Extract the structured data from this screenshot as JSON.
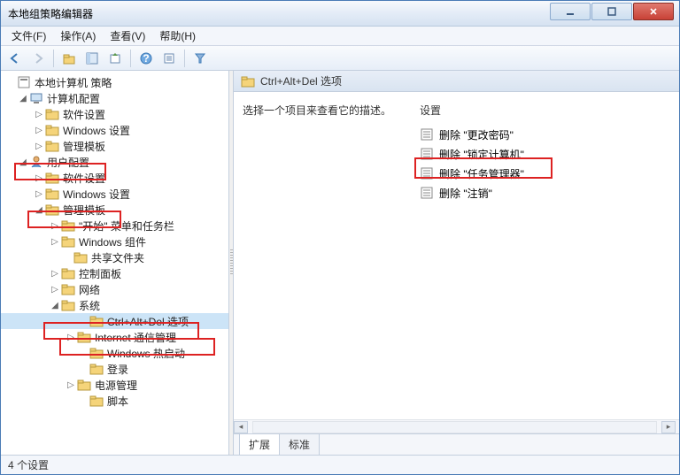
{
  "window": {
    "title": "本地组策略编辑器"
  },
  "menu": {
    "file": "文件(F)",
    "action": "操作(A)",
    "view": "查看(V)",
    "help": "帮助(H)"
  },
  "tree": {
    "root": "本地计算机 策略",
    "computer_config": "计算机配置",
    "cc_software": "软件设置",
    "cc_windows": "Windows 设置",
    "cc_admin": "管理模板",
    "user_config": "用户配置",
    "uc_software": "软件设置",
    "uc_windows": "Windows 设置",
    "uc_admin": "管理模板",
    "start_taskbar": "\"开始\" 菜单和任务栏",
    "win_components": "Windows 组件",
    "shared_folders": "共享文件夹",
    "control_panel": "控制面板",
    "network": "网络",
    "system": "系统",
    "ctrl_alt_del": "Ctrl+Alt+Del 选项",
    "internet_comm": "Internet 通信管理",
    "win_hotstart": "Windows 热启动",
    "logon": "登录",
    "power_mgmt": "电源管理",
    "scripts": "脚本"
  },
  "right": {
    "title": "Ctrl+Alt+Del 选项",
    "desc": "选择一个项目来查看它的描述。",
    "settings_header": "设置",
    "items": [
      "删除 \"更改密码\"",
      "删除 \"锁定计算机\"",
      "删除 \"任务管理器\"",
      "删除 \"注销\""
    ],
    "tabs": {
      "extended": "扩展",
      "standard": "标准"
    }
  },
  "status": "4 个设置"
}
